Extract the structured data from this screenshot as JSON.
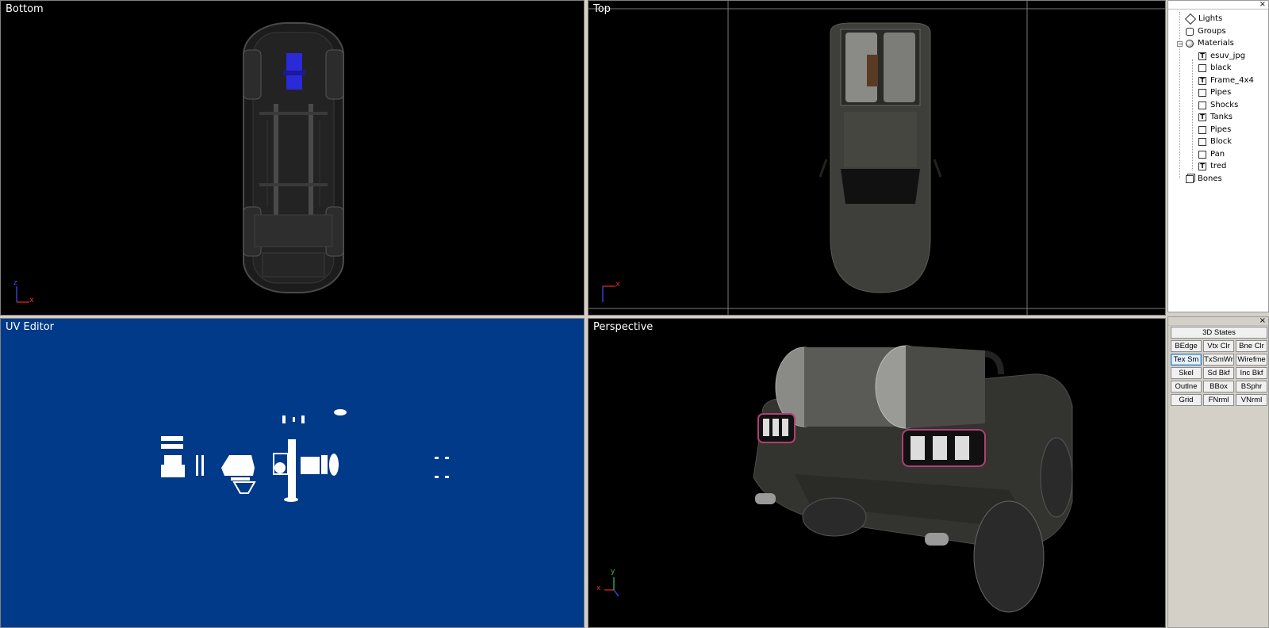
{
  "viewports": {
    "bottom": {
      "title": "Bottom"
    },
    "top": {
      "title": "Top"
    },
    "uv": {
      "title": "UV Editor"
    },
    "perspective": {
      "title": "Perspective"
    }
  },
  "axis": {
    "x": "x",
    "y": "y",
    "z": "z"
  },
  "tree": {
    "close": "×",
    "items": {
      "lights": "Lights",
      "groups": "Groups",
      "materials": "Materials",
      "m1": "esuv_jpg",
      "m2": "black",
      "m3": "Frame_4x4",
      "m4": "Pipes",
      "m5": "Shocks",
      "m6": "Tanks",
      "m7": "Pipes",
      "m8": "Block",
      "m9": "Pan",
      "m10": "tred",
      "bones": "Bones"
    },
    "expander": "−"
  },
  "states": {
    "close": "×",
    "header": "3D States",
    "buttons": {
      "b1": "BEdge",
      "b2": "Vtx Clr",
      "b3": "Bne Clr",
      "b4": "Tex Sm",
      "b5": "TxSmWr",
      "b6": "Wirefme",
      "b7": "Skel",
      "b8": "Sd Bkf",
      "b9": "Inc Bkf",
      "b10": "Outlne",
      "b11": "BBox",
      "b12": "BSphr",
      "b13": "Grid",
      "b14": "FNrml",
      "b15": "VNrml"
    },
    "active": "Tex Sm"
  },
  "colors": {
    "uv_background": "#003a88",
    "viewport_background": "#000000",
    "active_button_border": "#3c7fb1"
  }
}
